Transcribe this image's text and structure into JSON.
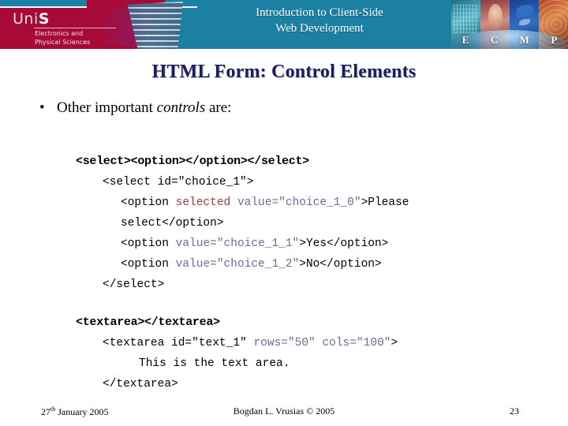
{
  "banner": {
    "title_line1": "Introduction to Client-Side",
    "title_line2": "Web Development",
    "logo_word_prefix": "Uni",
    "logo_word_accent": "S",
    "logo_subtitle": "Electronics and\nPhysical Sciences",
    "collage_letters": [
      "E",
      "C",
      "M",
      "P"
    ],
    "teal": "#1b80a4",
    "crimson": "#a80a38"
  },
  "slide": {
    "title": "HTML Form: Control Elements",
    "bullet_bullet": "•",
    "bullet_pre": "Other important ",
    "bullet_em": "controls",
    "bullet_post": " are:"
  },
  "code": {
    "select_heading": "<select><option></option></select>",
    "select_lines": [
      "<select id=\"choice_1\">",
      "<option ",
      "selected",
      " value=\"choice_1_0\"",
      ">Please select</option>",
      "<option ",
      "value=\"choice_1_1\"",
      ">Yes</option>",
      "<option ",
      "value=\"choice_1_2\"",
      ">No</option>",
      "</select>"
    ],
    "textarea_heading": "<textarea></textarea>",
    "textarea_lines": [
      "<textarea id=\"text_1\" ",
      "rows=\"50\" cols=\"100\"",
      ">",
      "This is the text area.",
      "</textarea>"
    ],
    "colors": {
      "keyword_red": "#9a3b3b",
      "attribute_blue": "#6b6b9e"
    }
  },
  "footer": {
    "date_number": "27",
    "date_suffix": "th",
    "date_rest": " January 2005",
    "author": "Bogdan L. Vrusias © 2005",
    "page": "23"
  }
}
